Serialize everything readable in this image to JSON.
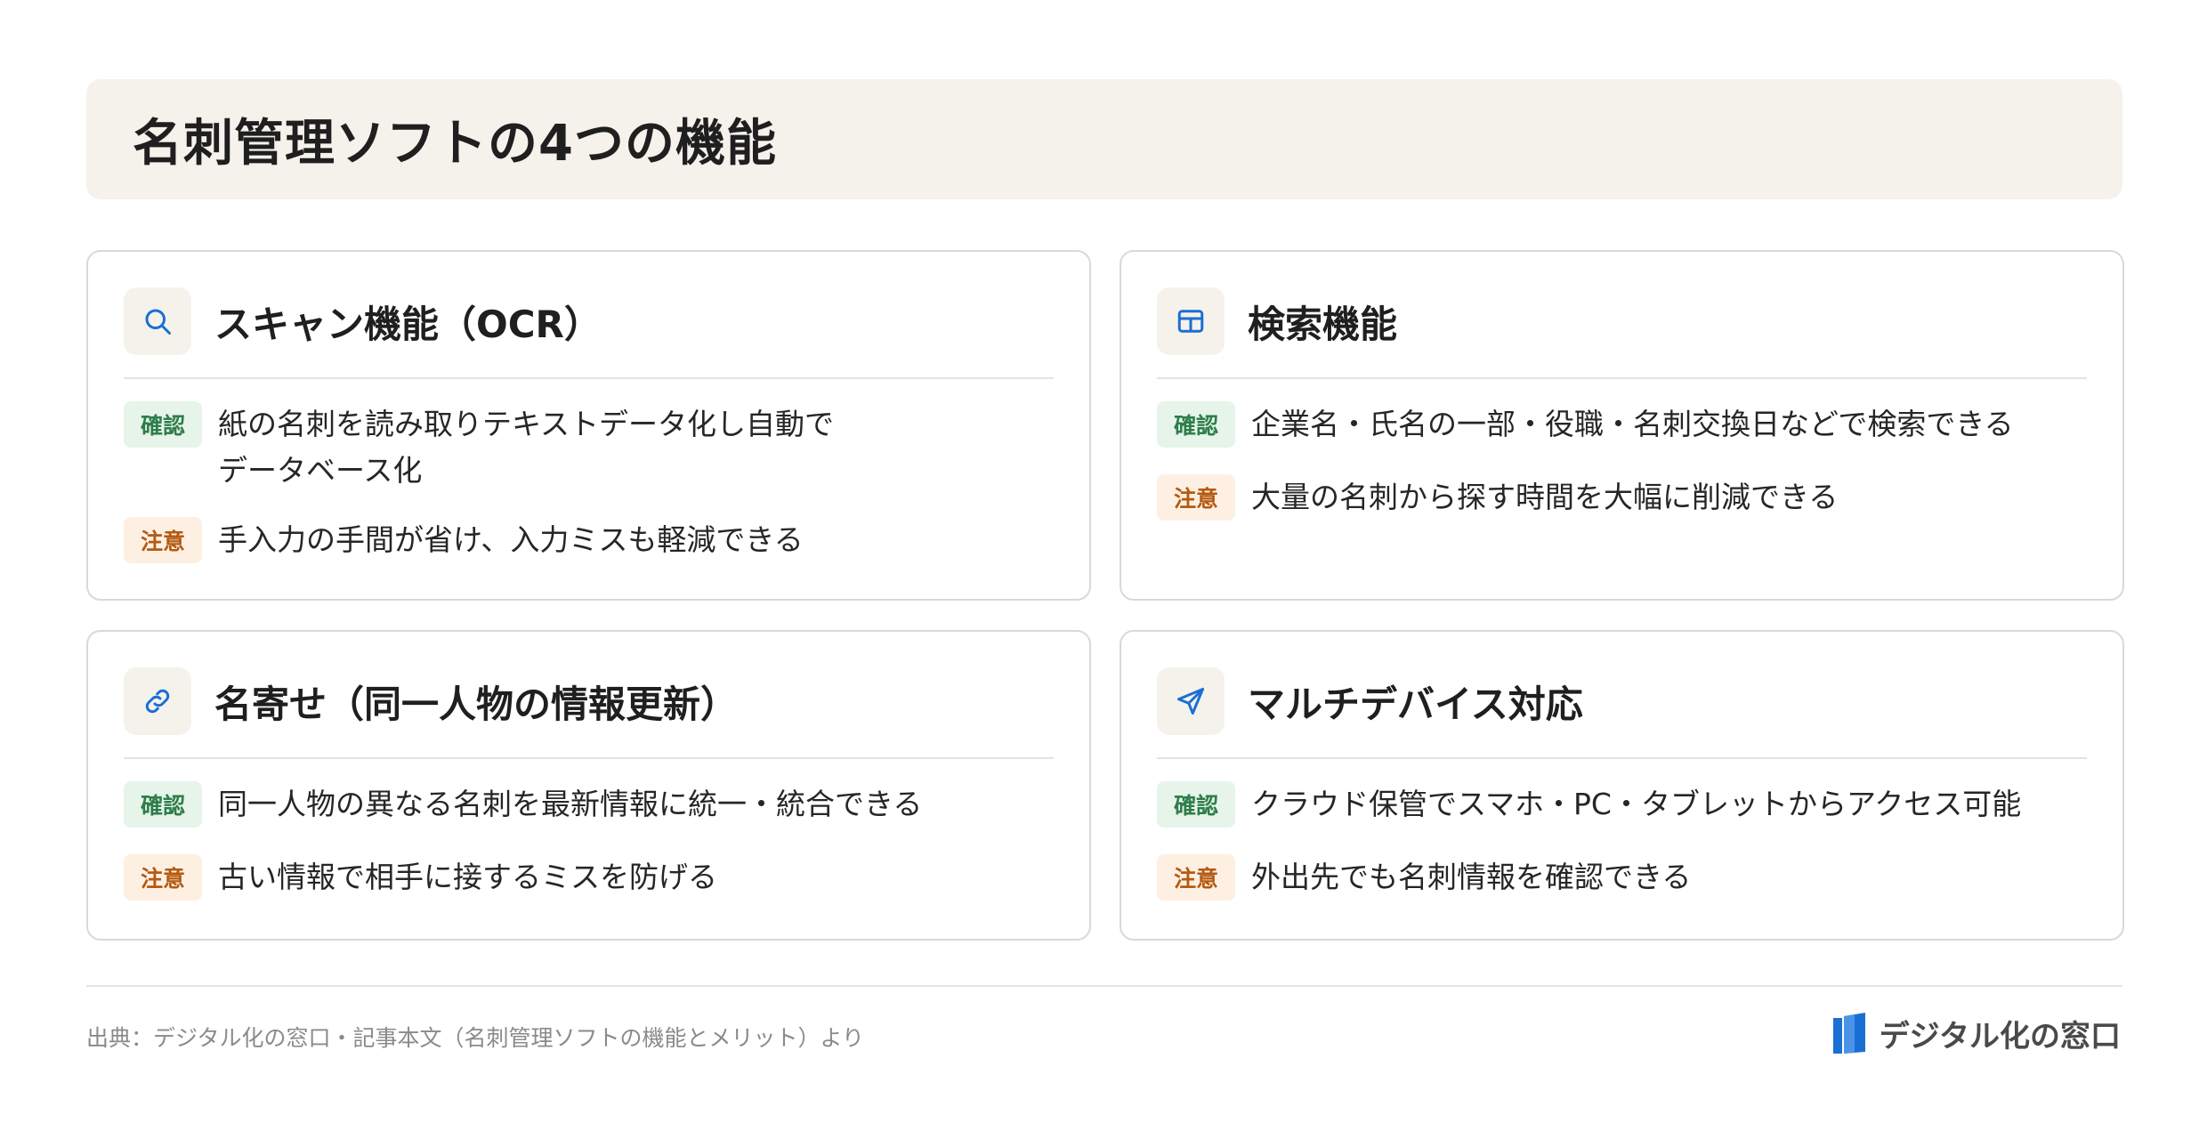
{
  "title": "名刺管理ソフトの4つの機能",
  "cards": [
    {
      "icon": "search-icon",
      "title": "スキャン機能（OCR）",
      "confirm_tag": "確認",
      "confirm_lines": [
        "紙の名刺を読み取りテキストデータ化し自動で",
        "データベース化"
      ],
      "caution_tag": "注意",
      "caution_text": "手入力の手間が省け、入力ミスも軽減できる"
    },
    {
      "icon": "table-icon",
      "title": "検索機能",
      "confirm_tag": "確認",
      "confirm_lines": [
        "企業名・氏名の一部・役職・名刺交換日などで検索できる"
      ],
      "caution_tag": "注意",
      "caution_text": "大量の名刺から探す時間を大幅に削減できる"
    },
    {
      "icon": "link-icon",
      "title": "名寄せ（同一人物の情報更新）",
      "confirm_tag": "確認",
      "confirm_lines": [
        "同一人物の異なる名刺を最新情報に統一・統合できる"
      ],
      "caution_tag": "注意",
      "caution_text": "古い情報で相手に接するミスを防げる"
    },
    {
      "icon": "send-icon",
      "title": "マルチデバイス対応",
      "confirm_tag": "確認",
      "confirm_lines": [
        "クラウド保管でスマホ・PC・タブレットからアクセス可能"
      ],
      "caution_tag": "注意",
      "caution_text": "外出先でも名刺情報を確認できる"
    }
  ],
  "footer": {
    "source": "出典：デジタル化の窓口・記事本文（名刺管理ソフトの機能とメリット）より",
    "brand": "デジタル化の窓口"
  },
  "colors": {
    "accent_blue": "#1a6fd4",
    "confirm_bg": "#e6f4ea",
    "confirm_text": "#2e7d4a",
    "caution_bg": "#fdf0e3",
    "caution_text": "#b45a12",
    "title_bg": "#f5f2ec"
  }
}
